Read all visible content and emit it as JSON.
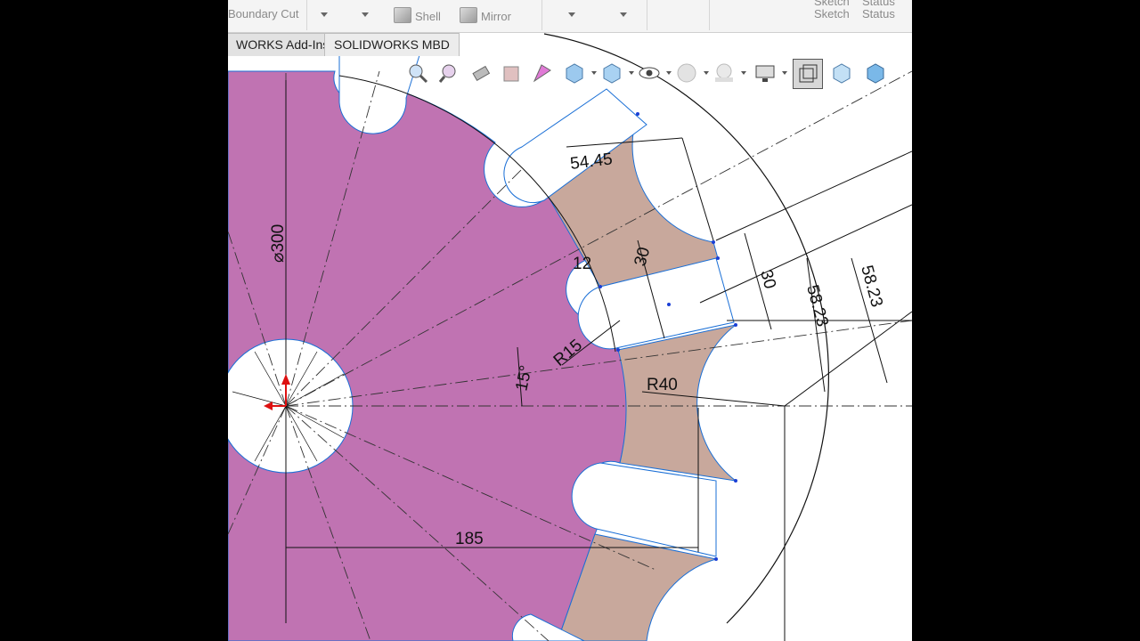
{
  "toolbar": {
    "boundary_cut": "Boundary Cut",
    "shell": "Shell",
    "mirror": "Mirror",
    "sketch_top": "Sketch",
    "status_top": "Status",
    "sketch": "Sketch",
    "status": "Status"
  },
  "tabs": [
    {
      "label": "WORKS Add-Ins"
    },
    {
      "label": "SOLIDWORKS MBD"
    }
  ],
  "view_toolbar": {
    "icons": [
      "zoom-to-fit-icon",
      "zoom-to-area-icon",
      "previous-view-icon",
      "section-view-icon",
      "dynamic-annotation-icon",
      "view-orientation-icon",
      "display-style-icon",
      "hide-show-items-icon",
      "edit-appearance-icon",
      "apply-scene-icon",
      "view-settings-icon",
      "wireframe-icon",
      "hidden-lines-visible-icon",
      "shaded-icon"
    ]
  },
  "dimensions": {
    "d_54_45": "54.45",
    "d_30_a": "30",
    "d_12": "12",
    "d_30_b": "30",
    "d_58_23_a": "58.23",
    "d_58_23_b": "58.23",
    "d_300": "⌀300",
    "r15": "R15",
    "angle": "15°",
    "r40": "R40",
    "d_185": "185"
  },
  "colors": {
    "body_fill": "#c073b2",
    "sketch_region_fill": "#c8a89c",
    "sketch_edge": "#1a6fd6",
    "dim_line": "#111111",
    "background": "#ffffff"
  }
}
